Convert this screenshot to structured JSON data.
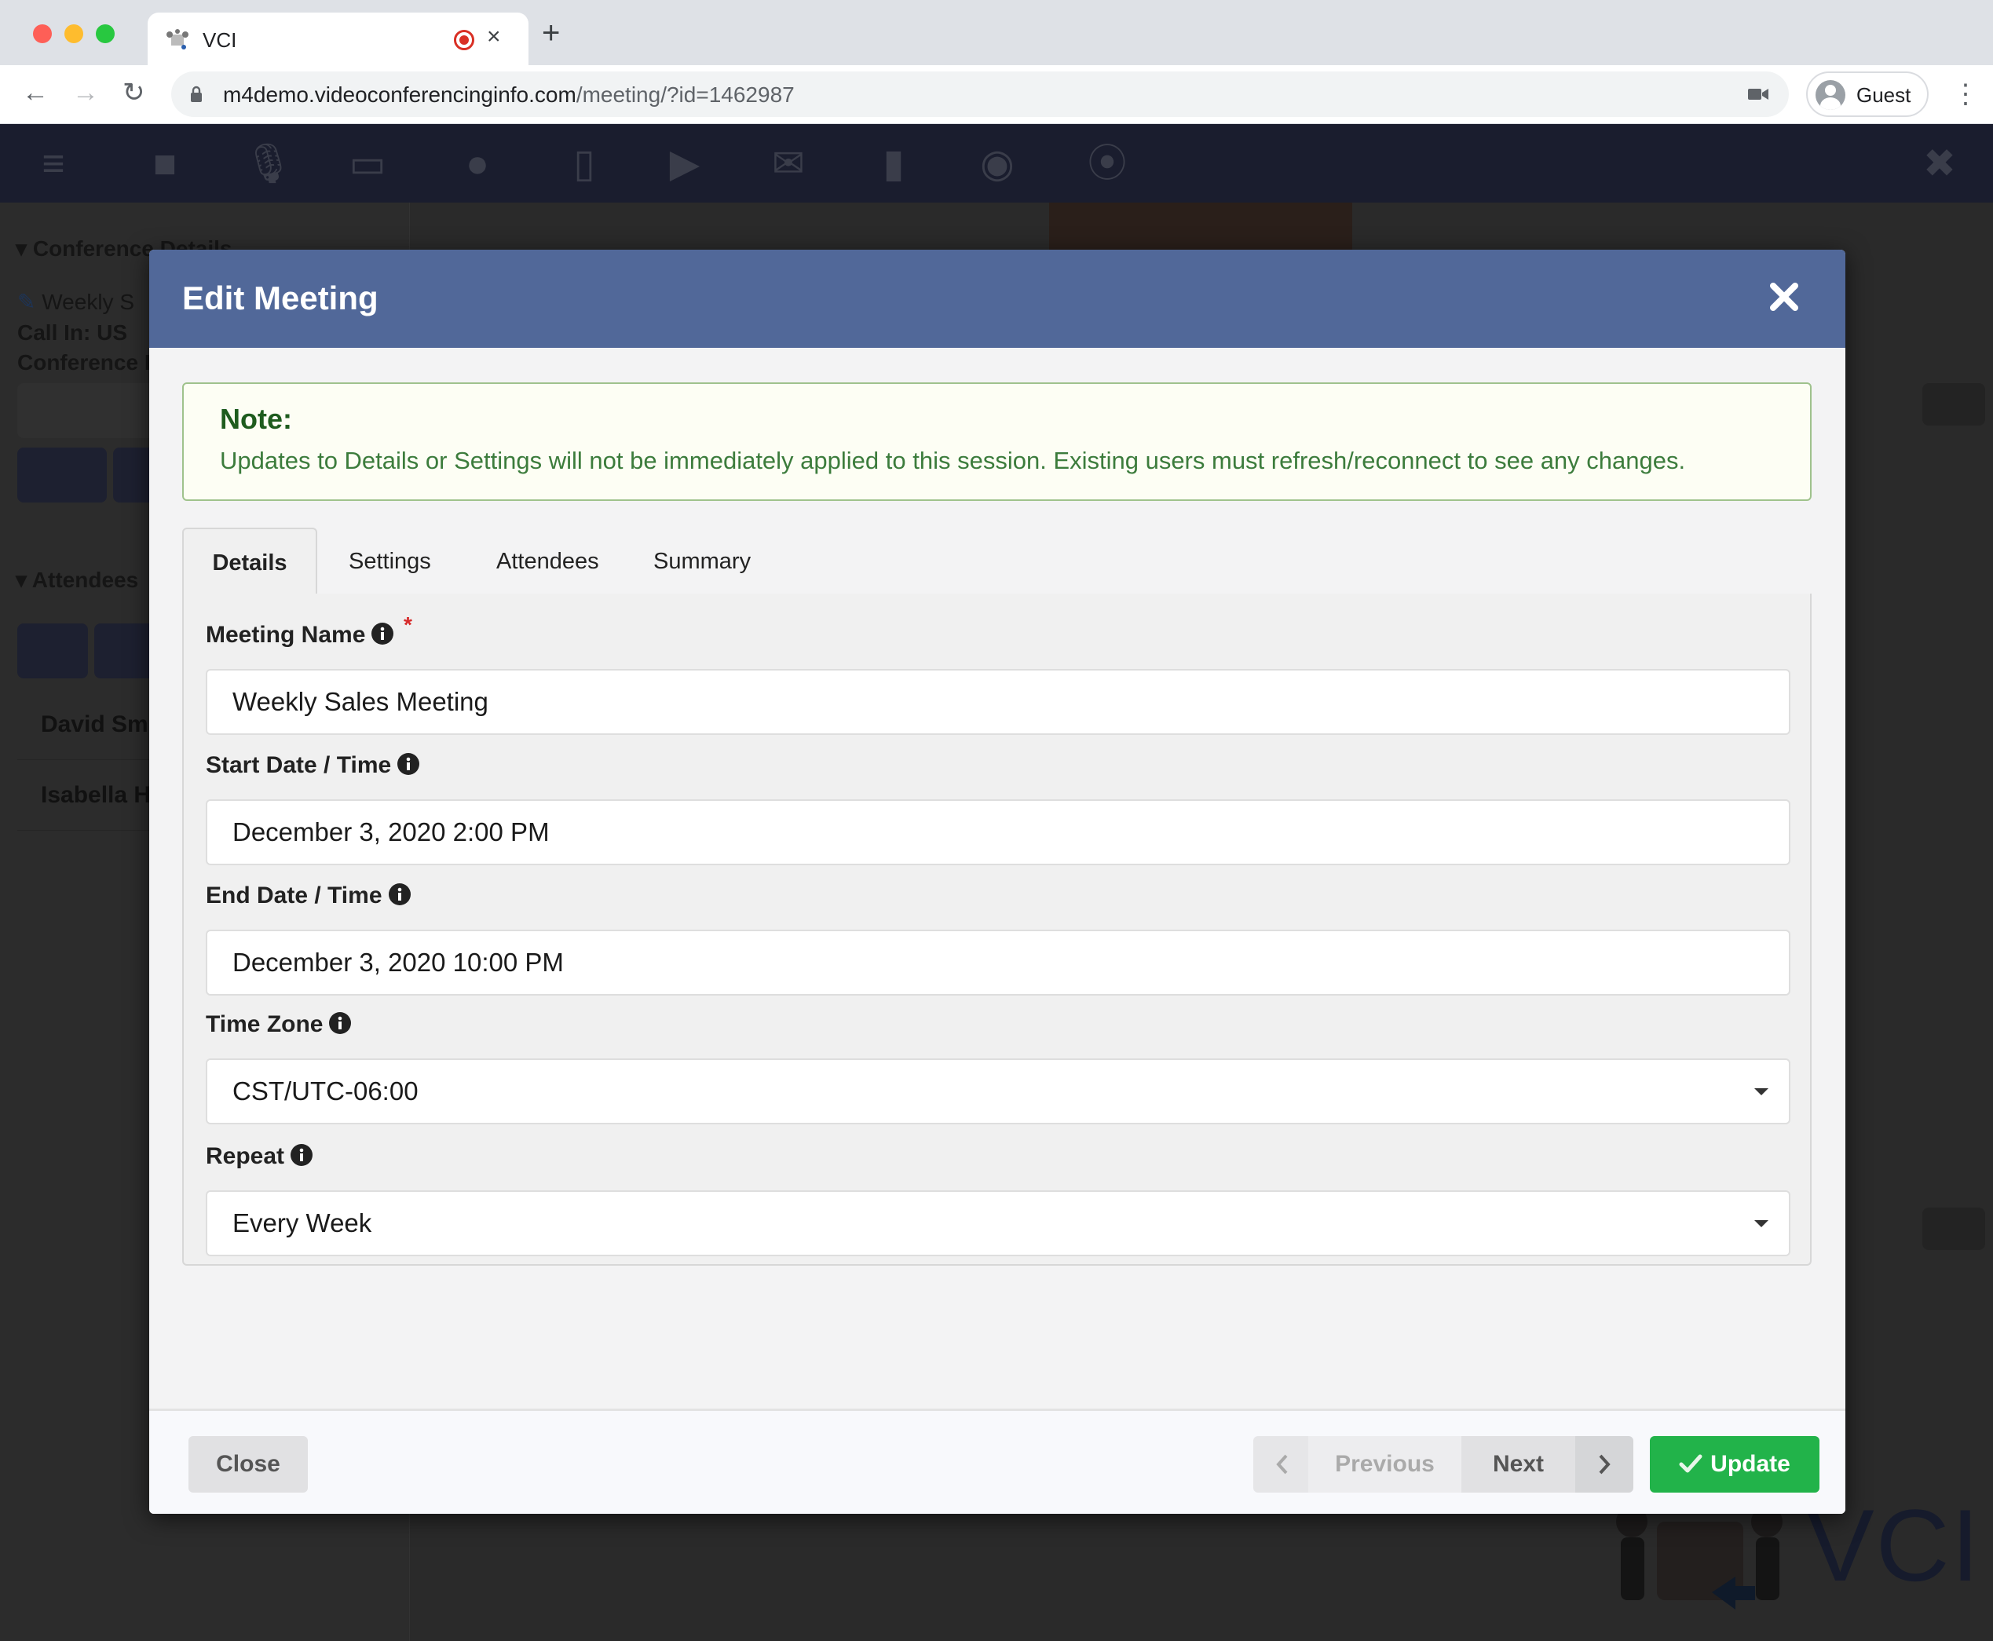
{
  "browser": {
    "tab_title": "VCI",
    "url_host": "m4demo.videoconferencinginfo.com",
    "url_path": "/meeting/?id=1462987",
    "profile_name": "Guest",
    "icons": {
      "back": "arrow-left-icon",
      "forward": "arrow-right-icon",
      "reload": "reload-icon",
      "lock": "lock-icon",
      "camera": "camera-icon",
      "menu": "kebab-menu-icon",
      "recording": "recording-dot-icon",
      "close_tab": "close-icon",
      "new_tab": "plus-icon"
    }
  },
  "app_background": {
    "toolbar_icons": [
      "menu-icon",
      "video-icon",
      "microphone-icon",
      "monitor-icon",
      "chat-icon",
      "document-icon",
      "media-player-icon",
      "envelope-icon",
      "exit-door-icon",
      "record-icon",
      "broadcast-icon"
    ],
    "close_icon": "close-icon",
    "sidebar": {
      "conference_section": "Conference Details",
      "meeting_name_partial": "Weekly S",
      "call_in_label": "Call In:",
      "call_in_value_partial": "US",
      "conference_id_partial": "Conference II",
      "attendees_section": "Attendees",
      "attendees": [
        "David Smi",
        "Isabella H"
      ]
    },
    "logo_text": "VCI"
  },
  "modal": {
    "title": "Edit Meeting",
    "note": {
      "title": "Note:",
      "body": "Updates to Details or Settings will not be immediately applied to this session. Existing users must refresh/reconnect to see any changes."
    },
    "tabs": [
      {
        "label": "Details",
        "active": true
      },
      {
        "label": "Settings",
        "active": false
      },
      {
        "label": "Attendees",
        "active": false
      },
      {
        "label": "Summary",
        "active": false
      }
    ],
    "fields": {
      "meeting_name": {
        "label": "Meeting Name",
        "required_marker": "*",
        "value": "Weekly Sales Meeting"
      },
      "start": {
        "label": "Start Date / Time",
        "value": "December 3, 2020 2:00 PM"
      },
      "end": {
        "label": "End Date / Time",
        "value": "December 3, 2020 10:00 PM"
      },
      "timezone": {
        "label": "Time Zone",
        "value": "CST/UTC-06:00"
      },
      "repeat": {
        "label": "Repeat",
        "value": "Every Week"
      }
    },
    "footer": {
      "close_label": "Close",
      "previous_label": "Previous",
      "next_label": "Next",
      "update_label": "Update"
    },
    "colors": {
      "header": "#516899",
      "note_border": "#9fc28c",
      "note_text": "#3c7c3c",
      "update_button": "#22b34a",
      "required": "#d62a2a"
    }
  }
}
